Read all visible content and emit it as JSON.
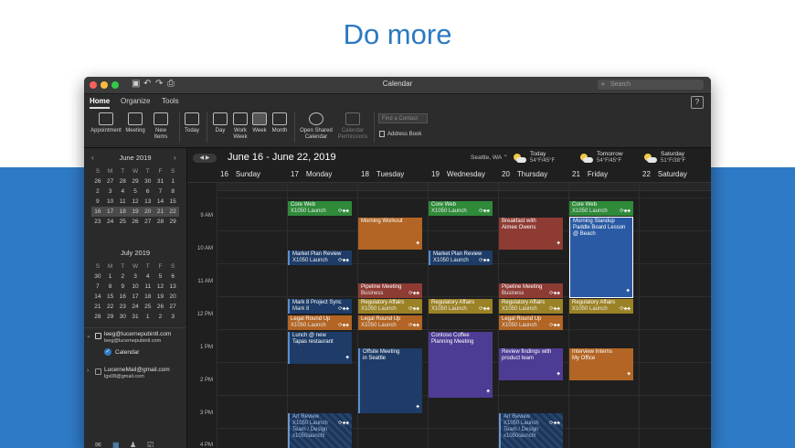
{
  "headline": "Do more",
  "window": {
    "title": "Calendar",
    "search_placeholder": "Search",
    "traffic_lights": [
      "#fc605b",
      "#fdbc40",
      "#34c84a"
    ]
  },
  "ribbon": {
    "tabs": [
      "Home",
      "Organize",
      "Tools"
    ],
    "buttons": {
      "appointment": "Appointment",
      "meeting": "Meeting",
      "new_items": "New\nItems",
      "today": "Today",
      "day": "Day",
      "work_week": "Work\nWeek",
      "week": "Week",
      "month": "Month",
      "open_shared": "Open Shared\nCalendar",
      "permissions": "Calendar\nPermissions"
    },
    "find_contact": "Find a Contact",
    "address_book": "Address Book"
  },
  "sidebar": {
    "june": {
      "title": "June 2019",
      "dow": [
        "S",
        "M",
        "T",
        "W",
        "T",
        "F",
        "S"
      ],
      "weeks": [
        [
          "26",
          "27",
          "28",
          "29",
          "30",
          "31",
          "1"
        ],
        [
          "2",
          "3",
          "4",
          "5",
          "6",
          "7",
          "8"
        ],
        [
          "9",
          "10",
          "11",
          "12",
          "13",
          "14",
          "15"
        ],
        [
          "16",
          "17",
          "18",
          "19",
          "20",
          "21",
          "22"
        ],
        [
          "23",
          "24",
          "25",
          "26",
          "27",
          "28",
          "29"
        ]
      ]
    },
    "july": {
      "title": "July 2019",
      "dow": [
        "S",
        "M",
        "T",
        "W",
        "T",
        "F",
        "S"
      ],
      "weeks": [
        [
          "30",
          "1",
          "2",
          "3",
          "4",
          "5",
          "6"
        ],
        [
          "7",
          "8",
          "9",
          "10",
          "11",
          "12",
          "13"
        ],
        [
          "14",
          "15",
          "16",
          "17",
          "18",
          "19",
          "20"
        ],
        [
          "21",
          "22",
          "23",
          "24",
          "25",
          "26",
          "27"
        ],
        [
          "28",
          "29",
          "30",
          "31",
          "1",
          "2",
          "3"
        ]
      ]
    },
    "accounts": [
      {
        "email": "leeg@lucernepubintl.com",
        "sub": "leeg@lucernepubintl.com",
        "calendar": "Calendar"
      },
      {
        "email": "LucerneMail@gmail.com",
        "sub": "lgs08@gmail.com"
      }
    ]
  },
  "toolbar": {
    "range": "June 16 - June 22, 2019",
    "location": "Seattle, WA",
    "weather": [
      {
        "day": "Today",
        "temp": "54°F/45°F"
      },
      {
        "day": "Tomorrow",
        "temp": "54°F/45°F"
      },
      {
        "day": "Saturday",
        "temp": "51°F/38°F"
      }
    ]
  },
  "days": [
    {
      "num": "16",
      "name": "Sunday"
    },
    {
      "num": "17",
      "name": "Monday"
    },
    {
      "num": "18",
      "name": "Tuesday"
    },
    {
      "num": "19",
      "name": "Wednesday"
    },
    {
      "num": "20",
      "name": "Thursday"
    },
    {
      "num": "21",
      "name": "Friday"
    },
    {
      "num": "22",
      "name": "Saturday"
    }
  ],
  "times": [
    "9 AM",
    "10 AM",
    "11 AM",
    "12 PM",
    "1 PM",
    "2 PM",
    "3 PM",
    "4 PM"
  ],
  "events": {
    "mon_core": {
      "title": "Core Web",
      "sub": "X1050 Launch",
      "icons": "⟳♣♣"
    },
    "mon_market": {
      "title": "Market Plan Review",
      "sub": "X1050 Launch",
      "icons": "⟳♣♣"
    },
    "mon_mark8": {
      "title": "Mark 8 Project Sync",
      "sub": "Mark 8",
      "icons": "⟳♣♣"
    },
    "mon_legal": {
      "title": "Legal Round Up",
      "sub": "X1050 Launch",
      "icons": "⟳♣♣"
    },
    "mon_lunch": {
      "title": "Lunch @ new\nTapas restaurant",
      "icons": "♣"
    },
    "mon_art": {
      "title": "Art Review",
      "sub": "X1050 Launch\nTeam / Design\nx1050launch!",
      "icons": "⟳♣♣"
    },
    "tue_workout": {
      "title": "Morning Workout",
      "icons": "♣"
    },
    "tue_pipeline": {
      "title": "Pipeline Meeting",
      "sub": "Business",
      "icons": "⟳♣♣"
    },
    "tue_reg": {
      "title": "Regulatory Affairs",
      "sub": "X1050 Launch",
      "icons": "⟳♣♣"
    },
    "tue_legal": {
      "title": "Legal Round Up",
      "sub": "X1050 Launch",
      "icons": "⟳♣♣"
    },
    "tue_offsite": {
      "title": "Offsite Meeting\nin Seattle",
      "icons": "♣"
    },
    "wed_core": {
      "title": "Core Web",
      "sub": "X1050 Launch",
      "icons": "⟳♣♣"
    },
    "wed_market": {
      "title": "Market Plan Review",
      "sub": "X1050 Launch",
      "icons": "⟳♣♣"
    },
    "wed_reg": {
      "title": "Regulatory Affairs",
      "sub": "X1050 Launch",
      "icons": "⟳♣♣"
    },
    "wed_contoso": {
      "title": "Contoso Coffee\nPlanning Meeting",
      "icons": "♣"
    },
    "thu_breakfast": {
      "title": "Breakfast with\nAimee Owens",
      "icons": "♣"
    },
    "thu_pipeline": {
      "title": "Pipeline Meeting",
      "sub": "Business",
      "icons": "⟳♣♣"
    },
    "thu_reg": {
      "title": "Regulatory Affairs",
      "sub": "X1050 Launch",
      "icons": "⟳♣♣"
    },
    "thu_legal": {
      "title": "Legal Round Up",
      "sub": "X1050 Launch",
      "icons": "⟳♣♣"
    },
    "thu_review": {
      "title": "Review findings with\nproduct team",
      "icons": "♣"
    },
    "thu_art": {
      "title": "Art Review",
      "sub": "X1050 Launch\nTeam / Design\nx1050launch!",
      "icons": "⟳♣♣"
    },
    "fri_core": {
      "title": "Core Web",
      "sub": "X1050 Launch",
      "icons": "⟳♣♣"
    },
    "fri_standup": {
      "title": "Morning Standup\nPaddle Board Lesson\n@ Beach",
      "icons": "♣"
    },
    "fri_reg": {
      "title": "Regulatory Affairs",
      "sub": "X1050 Launch",
      "icons": "⟳♣♣"
    },
    "fri_interns": {
      "title": "Interview Interns\nMy Office",
      "icons": "♣"
    }
  }
}
